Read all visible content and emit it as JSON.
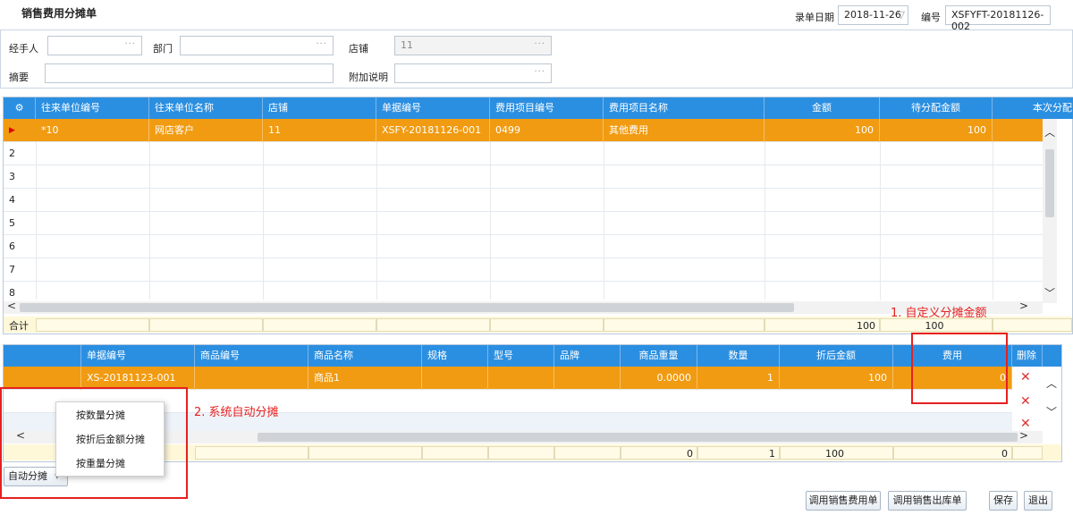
{
  "header": {
    "title": "销售费用分摊单",
    "date_label": "录单日期",
    "date_value": "2018-11-26",
    "no_label": "编号",
    "no_value": "XSFYFT-20181126-002"
  },
  "form": {
    "handler_label": "经手人",
    "dept_label": "部门",
    "store_label": "店铺",
    "store_value": "11",
    "summary_label": "摘要",
    "note_label": "附加说明",
    "dots": "···"
  },
  "top_grid": {
    "columns": [
      "往来单位编号",
      "往来单位名称",
      "店铺",
      "单据编号",
      "费用项目编号",
      "费用项目名称",
      "金额",
      "待分配金额",
      "本次分配"
    ],
    "rows": [
      {
        "no": "▶",
        "cells": [
          "*10",
          "网店客户",
          "11",
          "XSFY-20181126-001",
          "0499",
          "其他费用",
          "100",
          "100",
          ""
        ]
      },
      {
        "no": "2"
      },
      {
        "no": "3"
      },
      {
        "no": "4"
      },
      {
        "no": "5"
      },
      {
        "no": "6"
      },
      {
        "no": "7"
      },
      {
        "no": "8"
      }
    ],
    "sum_label": "合计",
    "sum_amount": "100",
    "sum_pending": "100"
  },
  "annotation1": "1. 自定义分摊金额",
  "annotation2": "2. 系统自动分摊",
  "bottom_grid": {
    "columns": [
      "单据编号",
      "商品编号",
      "商品名称",
      "规格",
      "型号",
      "品牌",
      "商品重量",
      "数量",
      "折后金额",
      "费用",
      "删除"
    ],
    "row": [
      "XS-20181123-001",
      "",
      "商品1",
      "",
      "",
      "",
      "0.0000",
      "1",
      "100",
      "0"
    ],
    "sums": [
      "0",
      "1",
      "100",
      "0"
    ]
  },
  "menu": {
    "items": [
      "按数量分摊",
      "按折后金额分摊",
      "按重量分摊"
    ]
  },
  "auto_label": "自动分摊",
  "buttons": {
    "call_fee": "调用销售费用单",
    "call_out": "调用销售出库单",
    "save": "保存",
    "exit": "退出"
  },
  "colors": {
    "header_blue": "#2b8fe1",
    "selected_orange": "#f19b12",
    "annotation_red": "#e62020"
  }
}
